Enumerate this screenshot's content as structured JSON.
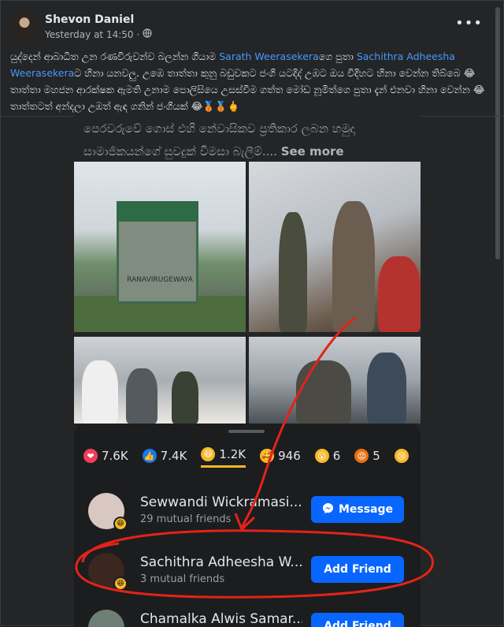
{
  "post": {
    "author": "Shevon Daniel",
    "timestamp": "Yesterday at 14:50",
    "privacy_symbol": "·",
    "privacy_icon": "globe-icon",
    "more_icon": "more-dots-icon",
    "more_glyph": "•••",
    "text_part1": "යුද්දෙන් ආබාධිත උන රණවිරුවන්ව බලන්න ගියාම ",
    "mention1": "Sarath Weerasekera",
    "text_part2": "ගෙ පුතා ",
    "mention2": "Sachithra Adheesha Weerasekera",
    "text_part3": "ට හිනා යනවලු. උඹෙ තාත්තා කුනු බඩුවකට ජංගි යටදිද් උඹට ඔය විදිහට හිනා වෙන්න තිබ්බෙ 😂 තාත්තා මහජන ආරක්ෂක ඇමති උනාම පොලිසියෙ උසස්වීම ගත්ත මෝඩ නූමිත්ගෙ පුතා දැන් එනවා හිනා වෙන්න 😂 තාත්තටත් අන්දලා උඹත් ඇඳ ගනින් ජංගියක් 😂🥉🥉🖕"
  },
  "shot": {
    "caption": "පෙරවරුවේ ගොස් එහි නේවාසිකව ප්‍රතිකාර ලබන හමුදා සාමාජිකයන්ගේ සුවදුක් විමසා බැලීම්....",
    "see_more": "See more",
    "sign_text": "RANAVIRUGEWAYA",
    "reactions": [
      {
        "emoji": "❤",
        "bg": "#f33e58",
        "count": "7.6K"
      },
      {
        "emoji": "👍",
        "bg": "#1877f2",
        "count": "7.4K"
      },
      {
        "emoji": "😆",
        "bg": "#f7b928",
        "count": "1.2K",
        "active": true
      },
      {
        "emoji": "🥰",
        "bg": "#f7b928",
        "count": "946"
      },
      {
        "emoji": "😮",
        "bg": "#f7b928",
        "count": "6"
      },
      {
        "emoji": "😡",
        "bg": "#e9710f",
        "count": "5"
      },
      {
        "emoji": "😢",
        "bg": "#f7b928",
        "count": ""
      }
    ],
    "friends": [
      {
        "name": "Sewwandi Wickramasi...",
        "mutual": "29 mutual friends",
        "button": "Message",
        "button_icon": "messenger-icon",
        "avatar_color": "#d9c7c2"
      },
      {
        "name": "Sachithra Adheesha W...",
        "mutual": "3 mutual friends",
        "button": "Add Friend",
        "button_icon": "",
        "avatar_color": "#3b2620"
      },
      {
        "name": "Chamalka Alwis Samar...",
        "mutual": "",
        "button": "Add Friend",
        "button_icon": "",
        "avatar_color": "#6e7f75"
      }
    ],
    "badge_emoji": "😆"
  },
  "colors": {
    "accent": "#0866ff",
    "mention": "#4599ff",
    "annotation": "#e3231a",
    "background": "#242526"
  }
}
